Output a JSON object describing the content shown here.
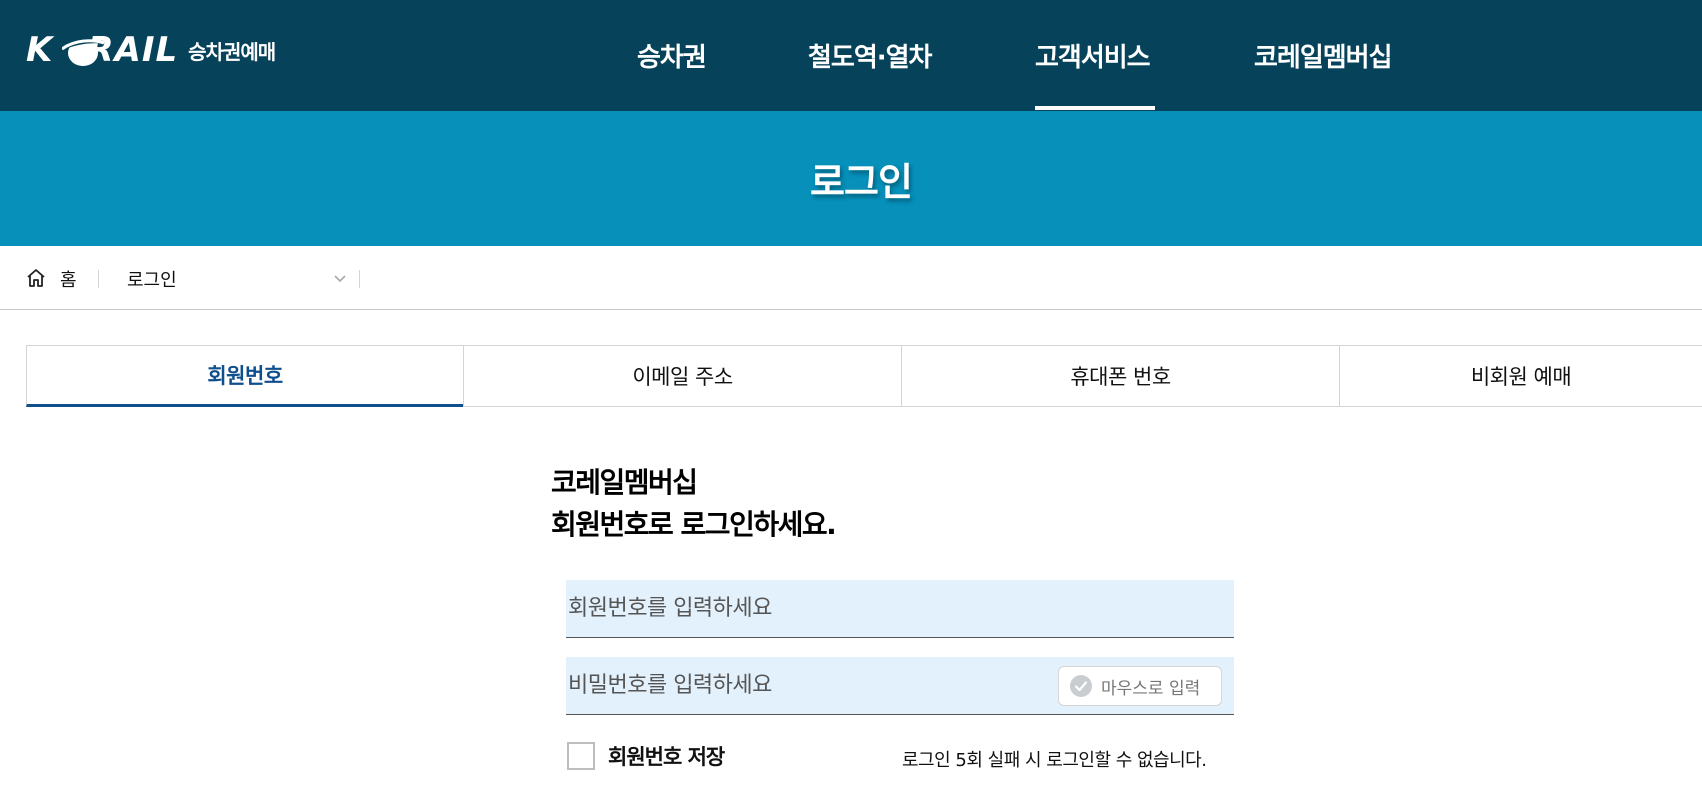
{
  "header": {
    "logo_word": "K RAIL",
    "logo_sub": "승차권예매",
    "nav": [
      {
        "label": "승차권"
      },
      {
        "label": "철도역·열차"
      },
      {
        "label": "고객서비스",
        "active": true
      },
      {
        "label": "코레일멤버십"
      }
    ],
    "colors": {
      "bar": "#06435a",
      "banner": "#0690ba",
      "active_tab": "#0f4f8e"
    }
  },
  "banner": {
    "title": "로그인"
  },
  "breadcrumb": {
    "home_label": "홈",
    "current": "로그인"
  },
  "tabs": [
    {
      "label": "회원번호",
      "active": true
    },
    {
      "label": "이메일 주소"
    },
    {
      "label": "휴대폰 번호"
    },
    {
      "label": "비회원 예매"
    }
  ],
  "login": {
    "heading_line1": "코레일멤버십",
    "heading_line2": "회원번호로 로그인하세요.",
    "member_placeholder": "회원번호를 입력하세요",
    "password_placeholder": "비밀번호를 입력하세요",
    "mouse_input_label": "마우스로 입력",
    "save_label": "회원번호 저장",
    "save_checked": false,
    "warning": "로그인 5회 실패 시 로그인할 수 없습니다."
  },
  "icons": {
    "home": "home-icon",
    "chevron": "chevron-down-icon",
    "check": "check-circle-icon"
  }
}
